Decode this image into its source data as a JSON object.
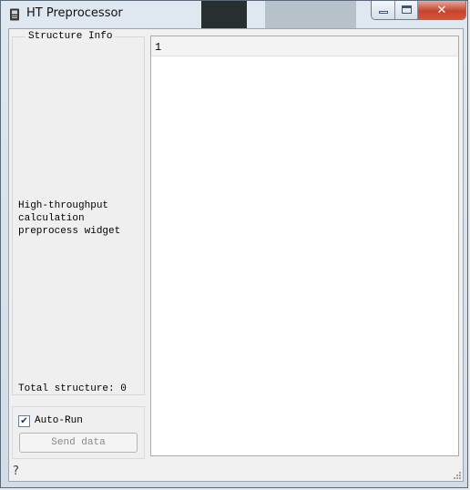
{
  "window": {
    "title": "HT Preprocessor",
    "close_glyph": "✕",
    "icons": {
      "app": "app-icon",
      "minimize": "minimize-icon",
      "maximize": "maximize-icon",
      "close": "close-icon"
    }
  },
  "sidebar": {
    "group_title": "Structure Info",
    "description": "High-throughput calculation preprocess widget",
    "total": "Total structure: 0"
  },
  "controls": {
    "auto_run_label": "Auto-Run",
    "auto_run_checked": true,
    "check_mark": "✔",
    "send_label": "Send data"
  },
  "editor": {
    "lines": [
      "1"
    ]
  },
  "footer": {
    "help_glyph": "?",
    "icons": {
      "help": "help-icon",
      "grip": "resize-grip-icon"
    }
  },
  "colors": {
    "close_button": "#c7442c",
    "frame": "#d2dce6"
  }
}
